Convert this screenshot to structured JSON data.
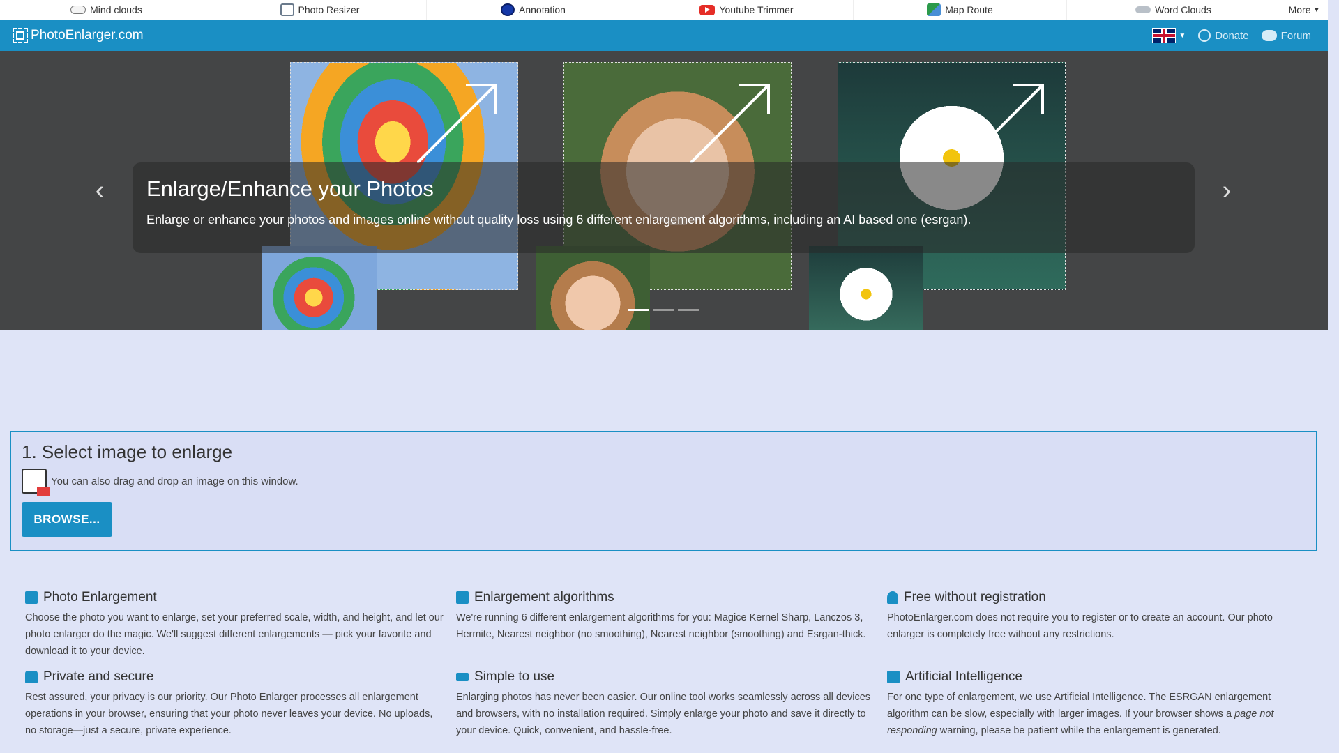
{
  "top_apps": [
    {
      "label": "Mind clouds",
      "icon": "mind-clouds-icon"
    },
    {
      "label": "Photo Resizer",
      "icon": "photo-resizer-icon"
    },
    {
      "label": "Annotation",
      "icon": "annotation-icon"
    },
    {
      "label": "Youtube Trimmer",
      "icon": "youtube-icon"
    },
    {
      "label": "Map Route",
      "icon": "map-icon"
    },
    {
      "label": "Word Clouds",
      "icon": "cloud-icon"
    }
  ],
  "more_label": "More",
  "header": {
    "site_name": "PhotoEnlarger.com",
    "donate": "Donate",
    "forum": "Forum",
    "accent": "#1a8fc4"
  },
  "carousel": {
    "title": "Enlarge/Enhance your Photos",
    "subtitle": "Enlarge or enhance your photos and images online without quality loss using 6 different enlargement algorithms, including an AI based one (esrgan).",
    "active_slide": 1,
    "slide_count": 3
  },
  "select": {
    "heading": "1. Select image to enlarge",
    "drag_text": "You can also drag and drop an image on this window.",
    "browse_label": "BROWSE..."
  },
  "features": [
    {
      "title": "Photo Enlargement",
      "icon": "image-icon",
      "text": "Choose the photo you want to enlarge, set your preferred scale, width, and height, and let our photo enlarger do the magic. We'll suggest different enlargements — pick your favorite and download it to your device."
    },
    {
      "title": "Enlargement algorithms",
      "icon": "algorithm-icon",
      "text": "We're running 6 different enlargement algorithms for you: Magice Kernel Sharp, Lanczos 3, Hermite, Nearest neighbor (no smoothing), Nearest neighbor (smoothing) and Esrgan-thick."
    },
    {
      "title": "Free without registration",
      "icon": "user-icon",
      "text": "PhotoEnlarger.com does not require you to register or to create an account. Our photo enlarger is completely free without any restrictions."
    },
    {
      "title": "Private and secure",
      "icon": "lock-icon",
      "text": "Rest assured, your privacy is our priority. Our Photo Enlarger processes all enlargement operations in your browser, ensuring that your photo never leaves your device. No uploads, no storage—just a secure, private experience."
    },
    {
      "title": "Simple to use",
      "icon": "flag-icon",
      "text": "Enlarging photos has never been easier. Our online tool works seamlessly across all devices and browsers, with no installation required. Simply enlarge your photo and save it directly to your device. Quick, convenient, and hassle-free."
    },
    {
      "title": "Artificial Intelligence",
      "icon": "server-icon",
      "text_pre": "For one type of enlargement, we use Artificial Intelligence. The ESRGAN enlargement algorithm can be slow, especially with larger images. If your browser shows a ",
      "text_em": "page not responding",
      "text_post": " warning, please be patient while the enlargement is generated."
    }
  ]
}
